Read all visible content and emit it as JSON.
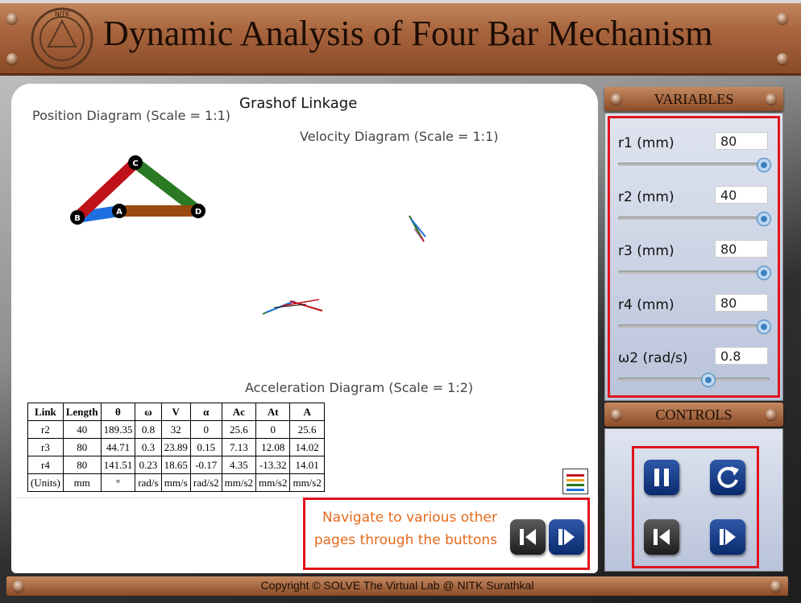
{
  "header": {
    "title": "Dynamic Analysis of Four Bar Mechanism",
    "logo_text": "NITK"
  },
  "diagram": {
    "linkage_type": "Grashof Linkage",
    "position_label": "Position Diagram (Scale = 1:1)",
    "velocity_label": "Velocity Diagram (Scale = 1:1)",
    "acceleration_label": "Acceleration Diagram (Scale = 1:2)",
    "joints": [
      "B",
      "A",
      "C",
      "D"
    ],
    "colors": {
      "r2": "#1e6fe0",
      "r3": "#c0121a",
      "r4": "#2a7a24",
      "r1": "#9a4a10"
    }
  },
  "table": {
    "headers": [
      "Link",
      "Length",
      "θ",
      "ω",
      "V",
      "α",
      "Ac",
      "At",
      "A"
    ],
    "rows": [
      [
        "r2",
        "40",
        "189.35",
        "0.8",
        "32",
        "0",
        "25.6",
        "0",
        "25.6"
      ],
      [
        "r3",
        "80",
        "44.71",
        "0.3",
        "23.89",
        "0.15",
        "7.13",
        "12.08",
        "14.02"
      ],
      [
        "r4",
        "80",
        "141.51",
        "0.23",
        "18.65",
        "-0.17",
        "4.35",
        "-13.32",
        "14.01"
      ],
      [
        "(Units)",
        "mm",
        "°",
        "rad/s",
        "mm/s",
        "rad/s2",
        "mm/s2",
        "mm/s2",
        "mm/s2"
      ]
    ]
  },
  "navigation": {
    "hint": "Navigate to various other pages through the buttons"
  },
  "variables": {
    "title": "VARIABLES",
    "items": [
      {
        "label": "r1 (mm)",
        "value": "80",
        "fraction": 1.0
      },
      {
        "label": "r2 (mm)",
        "value": "40",
        "fraction": 1.0
      },
      {
        "label": "r3 (mm)",
        "value": "80",
        "fraction": 1.0
      },
      {
        "label": "r4 (mm)",
        "value": "80",
        "fraction": 1.0
      },
      {
        "label": "ω2 (rad/s)",
        "value": "0.8",
        "fraction": 0.6
      }
    ]
  },
  "controls": {
    "title": "CONTROLS"
  },
  "footer": {
    "copyright": "Copyright © SOLVE The Virtual Lab @ NITK Surathkal"
  }
}
